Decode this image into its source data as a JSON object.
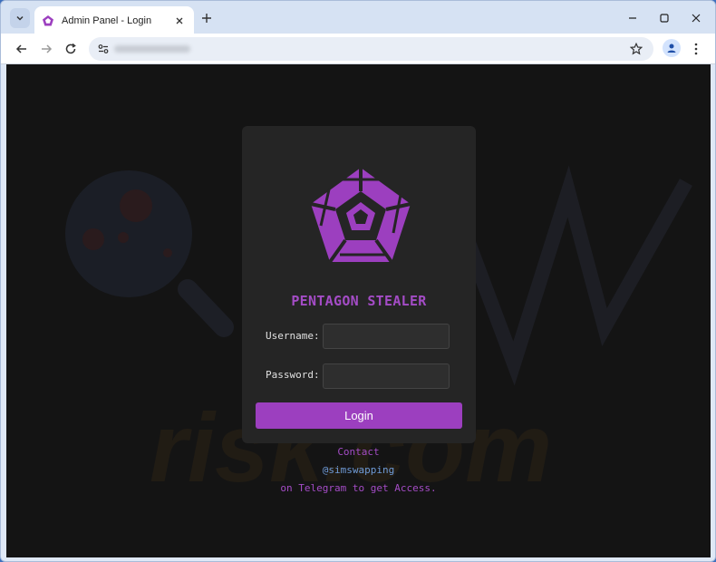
{
  "browser": {
    "tab_title": "Admin Panel - Login",
    "url_obscured": true
  },
  "page": {
    "brand": "PENTAGON STEALER",
    "form": {
      "username_label": "Username:",
      "username_value": "",
      "password_label": "Password:",
      "password_value": "",
      "login_button": "Login"
    },
    "footer": {
      "contact": "Contact",
      "handle": "@simswapping",
      "note": "on Telegram to get Access."
    },
    "watermark_text": "risk.com"
  },
  "colors": {
    "accent": "#9c3fbf",
    "brand_text": "#a44cc6",
    "page_bg": "#141414",
    "card_bg": "#252525",
    "link_blue": "#6f9bd8"
  }
}
